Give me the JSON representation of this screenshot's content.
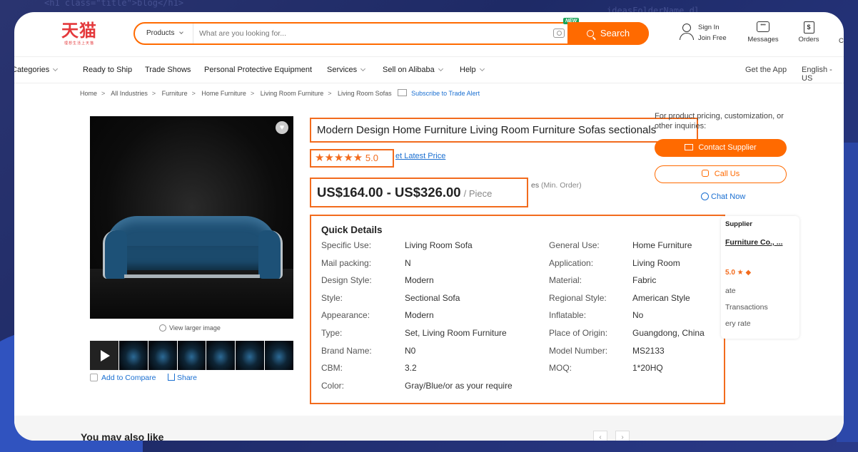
{
  "background": {
    "code_snippet": "<h1 class=\"title\">blog</h1>",
    "code_snippet_right": "ideasFolderName.dl"
  },
  "header": {
    "logo_main": "天猫",
    "logo_sub": "理想生活上天猫",
    "search": {
      "category": "Products",
      "placeholder": "What are you looking for...",
      "new_badge": "NEW",
      "button_label": "Search"
    },
    "signin_line1": "Sign In",
    "signin_line2": "Join Free",
    "messages_label": "Messages",
    "orders_label": "Orders",
    "extra_label": "C"
  },
  "nav": {
    "categories": "Categories",
    "ready_to_ship": "Ready to Ship",
    "trade_shows": "Trade Shows",
    "ppe": "Personal Protective Equipment",
    "services": "Services",
    "sell": "Sell on Alibaba",
    "help": "Help",
    "get_app": "Get the App",
    "language": "English - US"
  },
  "breadcrumb": {
    "items": [
      "Home",
      "All Industries",
      "Furniture",
      "Home Furniture",
      "Living Room Furniture",
      "Living Room Sofas"
    ],
    "alert": "Subscribe to Trade Alert"
  },
  "gallery": {
    "view_larger": "View larger image",
    "add_to_compare": "Add to Compare",
    "share": "Share"
  },
  "product": {
    "title": "Modern Design Home Furniture Living Room Furniture Sofas sectionals",
    "rating": "5.0",
    "stars": "★★★★★",
    "get_latest_price": "et Latest Price",
    "price": "US$164.00 - US$326.00",
    "unit": "/ Piece",
    "min_order_prefix": "es",
    "min_order": "(Min. Order)"
  },
  "quick_details": {
    "title": "Quick Details",
    "rows": [
      {
        "k1": "Specific Use:",
        "v1": "Living Room Sofa",
        "k2": "General Use:",
        "v2": "Home Furniture"
      },
      {
        "k1": "Mail packing:",
        "v1": "N",
        "k2": "Application:",
        "v2": "Living Room"
      },
      {
        "k1": "Design Style:",
        "v1": "Modern",
        "k2": "Material:",
        "v2": "Fabric"
      },
      {
        "k1": "Style:",
        "v1": "Sectional Sofa",
        "k2": "Regional Style:",
        "v2": "American Style"
      },
      {
        "k1": "Appearance:",
        "v1": "Modern",
        "k2": "Inflatable:",
        "v2": "No"
      },
      {
        "k1": "Type:",
        "v1": "Set, Living Room Furniture",
        "k2": "Place of Origin:",
        "v2": "Guangdong, China"
      },
      {
        "k1": "Brand Name:",
        "v1": "N0",
        "k2": "Model Number:",
        "v2": "MS2133"
      },
      {
        "k1": "CBM:",
        "v1": "3.2",
        "k2": "MOQ:",
        "v2": "1*20HQ"
      },
      {
        "k1": "Color:",
        "v1": "Gray/Blue/or as your require",
        "k2": "",
        "v2": ""
      }
    ]
  },
  "supplier": {
    "pricing_text": "For product pricing, customization, or other inquiries:",
    "contact_button": "Contact Supplier",
    "call_button": "Call Us",
    "chat_now": "Chat Now",
    "badge": "Supplier",
    "name": "Furniture Co., ...",
    "rating": "5.0 ★",
    "line1": "ate",
    "line2": "Transactions",
    "line3": "ery rate"
  },
  "recommend": {
    "title": "You may also like"
  }
}
